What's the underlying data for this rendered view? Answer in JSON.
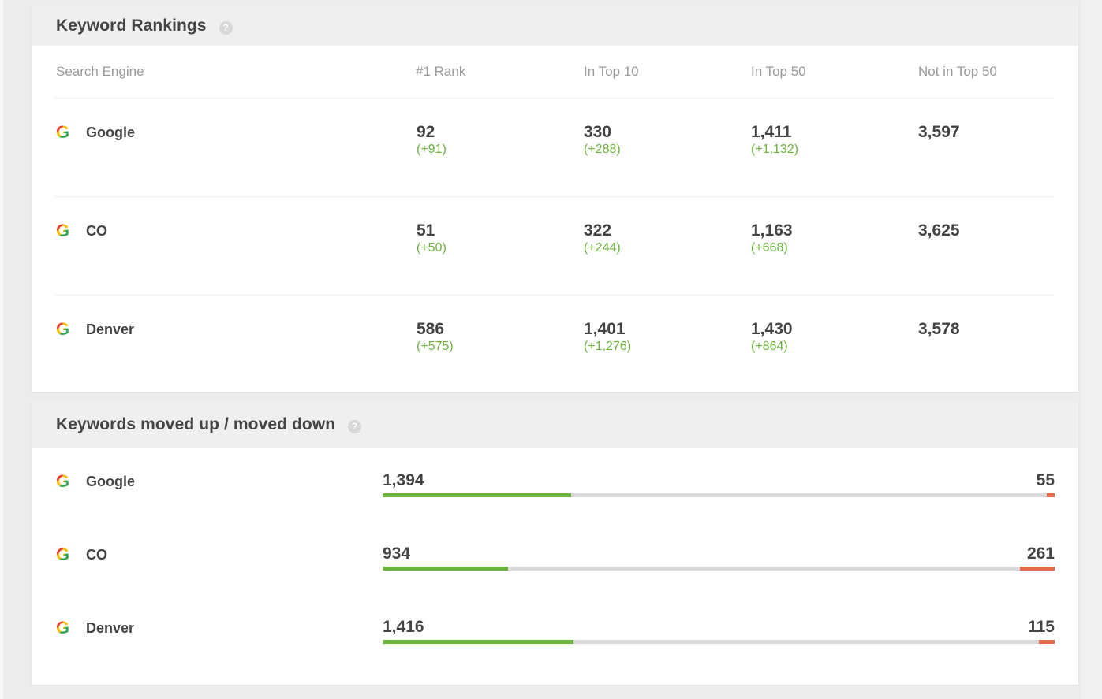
{
  "rankings": {
    "title": "Keyword Rankings",
    "help_icon": "?",
    "columns": [
      "Search Engine",
      "#1 Rank",
      "In Top 10",
      "In Top 50",
      "Not in Top 50"
    ],
    "rows": [
      {
        "engine": "Google",
        "icon": "google-g-icon",
        "rank1": "92",
        "rank1_delta": "(+91)",
        "top10": "330",
        "top10_delta": "(+288)",
        "top50": "1,411",
        "top50_delta": "(+1,132)",
        "not50": "3,597"
      },
      {
        "engine": "CO",
        "icon": "google-g-icon",
        "rank1": "51",
        "rank1_delta": "(+50)",
        "top10": "322",
        "top10_delta": "(+244)",
        "top50": "1,163",
        "top50_delta": "(+668)",
        "not50": "3,625"
      },
      {
        "engine": "Denver",
        "icon": "google-g-icon",
        "rank1": "586",
        "rank1_delta": "(+575)",
        "top10": "1,401",
        "top10_delta": "(+1,276)",
        "top50": "1,430",
        "top50_delta": "(+864)",
        "not50": "3,578"
      }
    ]
  },
  "moves": {
    "title": "Keywords moved up / moved down",
    "help_icon": "?",
    "colors": {
      "up": "#6cb33f",
      "down": "#e2694a",
      "track": "#d9d9d9"
    },
    "rows": [
      {
        "engine": "Google",
        "icon": "google-g-icon",
        "up": "1,394",
        "down": "55",
        "up_fraction": 0.28,
        "down_fraction": 0.012
      },
      {
        "engine": "CO",
        "icon": "google-g-icon",
        "up": "934",
        "down": "261",
        "up_fraction": 0.187,
        "down_fraction": 0.052
      },
      {
        "engine": "Denver",
        "icon": "google-g-icon",
        "up": "1,416",
        "down": "115",
        "up_fraction": 0.284,
        "down_fraction": 0.023
      }
    ]
  }
}
